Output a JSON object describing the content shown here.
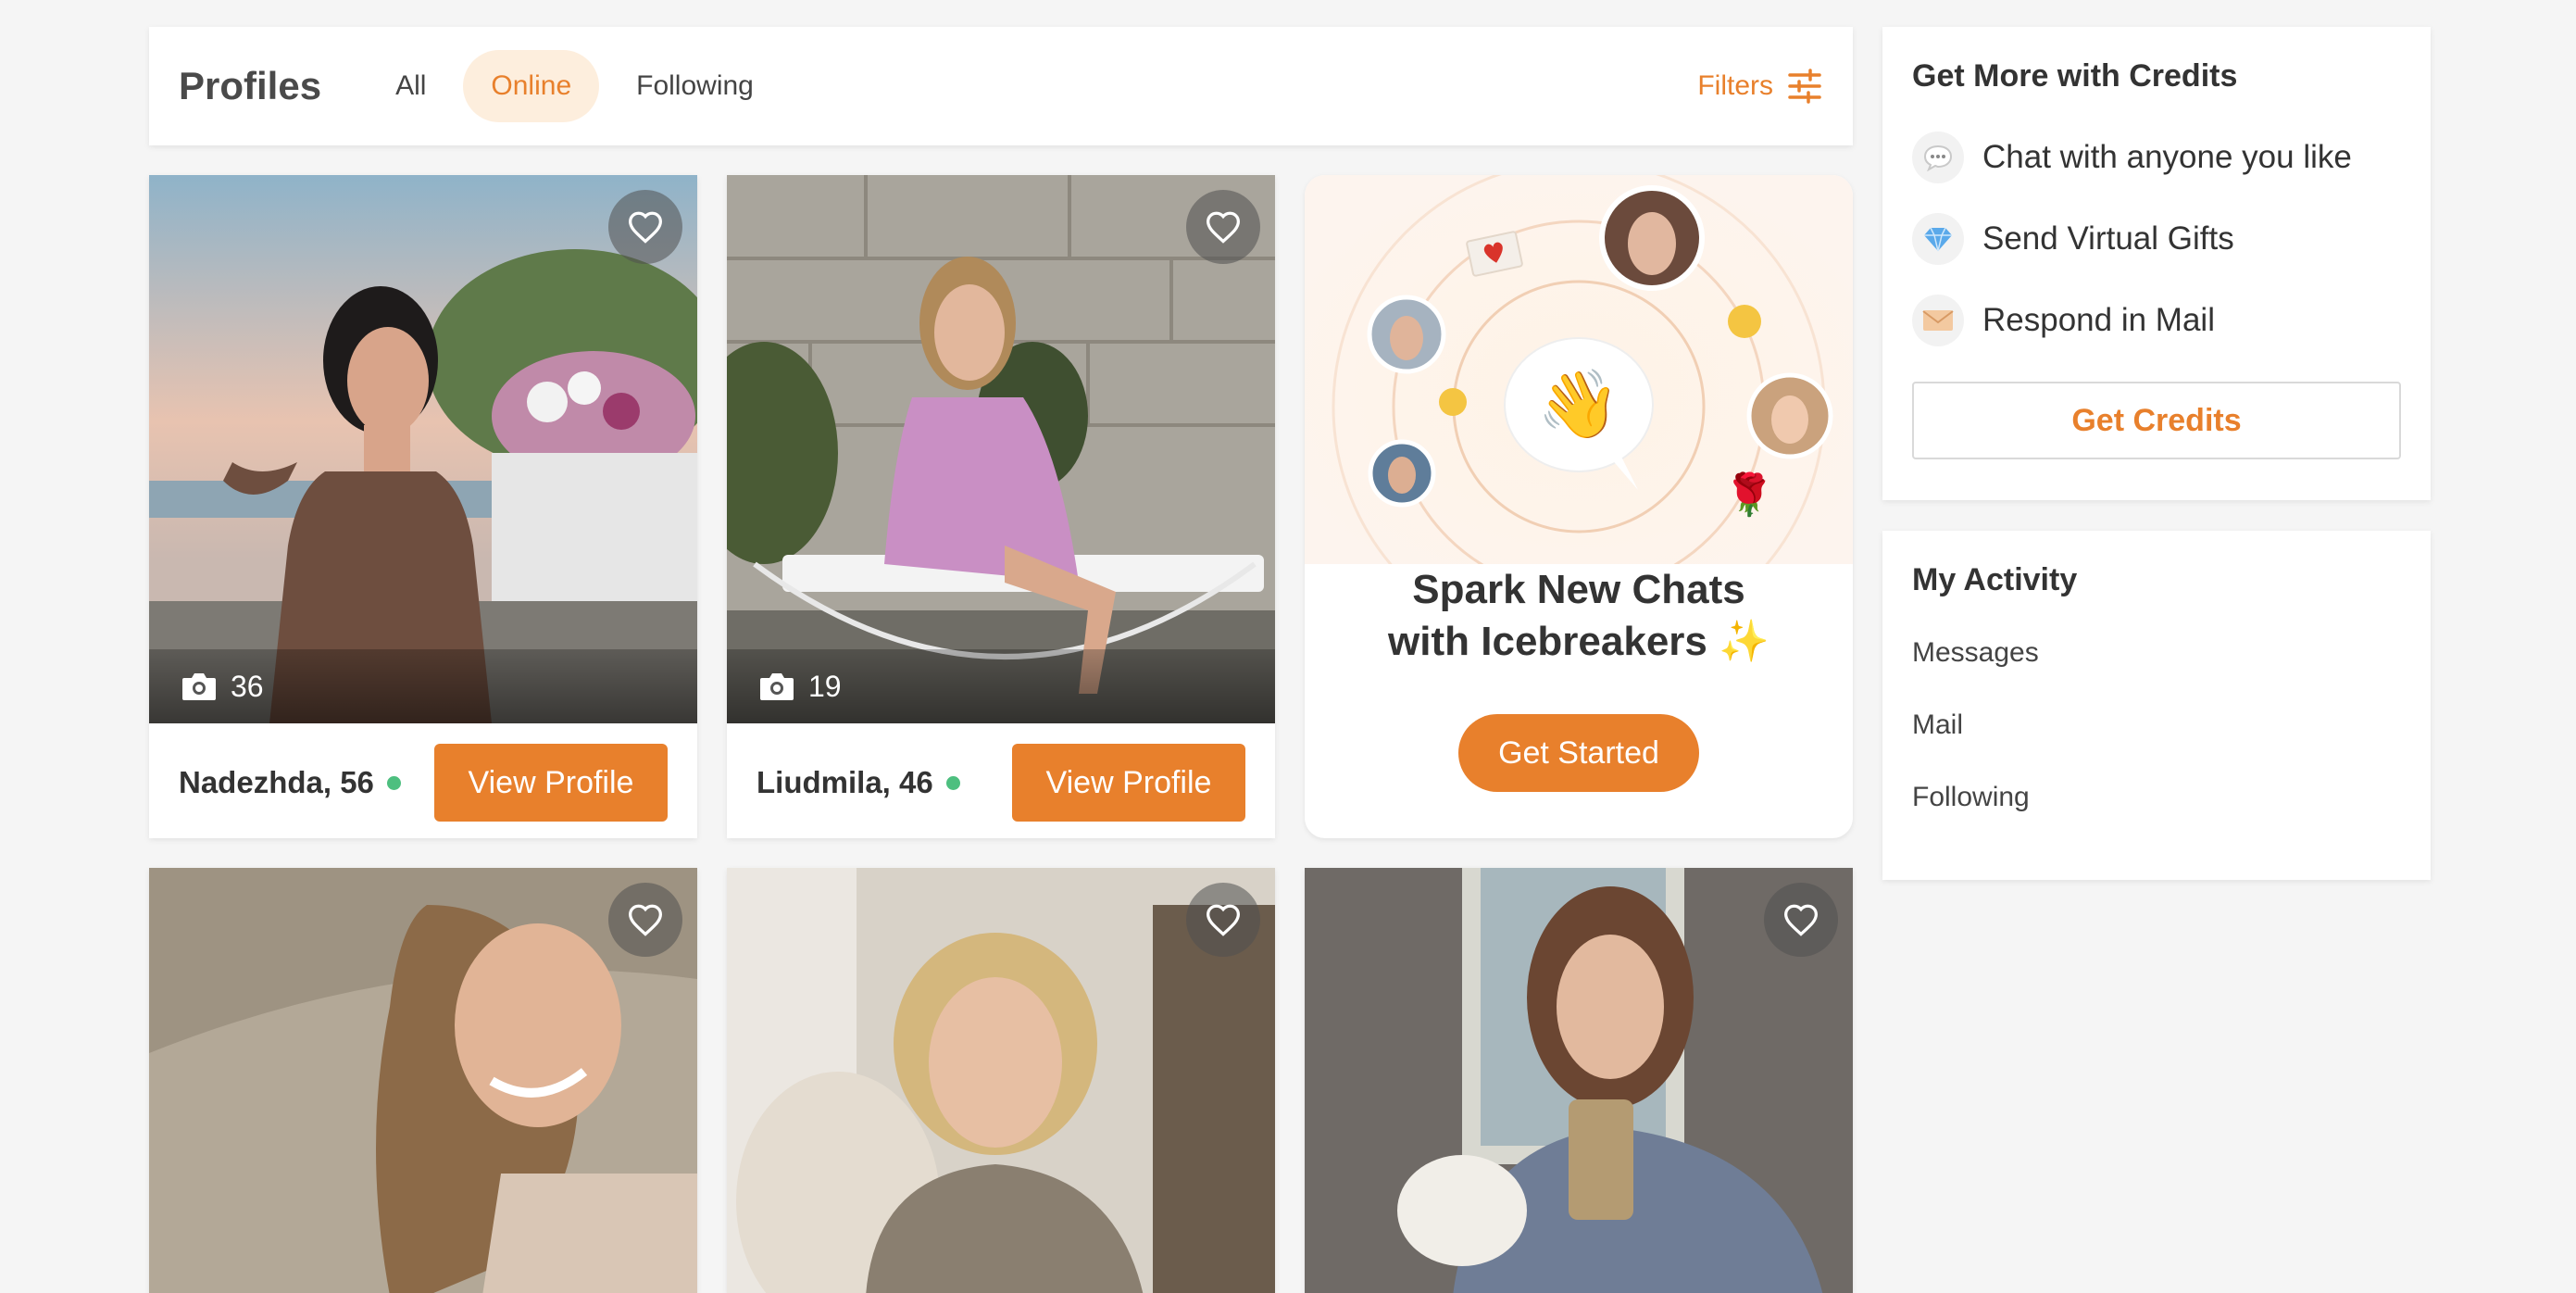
{
  "header": {
    "title": "Profiles",
    "tabs": [
      {
        "label": "All",
        "active": false
      },
      {
        "label": "Online",
        "active": true
      },
      {
        "label": "Following",
        "active": false
      }
    ],
    "filters_label": "Filters"
  },
  "profiles": [
    {
      "name": "Nadezhda, 56",
      "photo_count": "36",
      "online": true,
      "button": "View Profile"
    },
    {
      "name": "Liudmila, 46",
      "photo_count": "19",
      "online": true,
      "button": "View Profile"
    }
  ],
  "icebreaker": {
    "title_line1": "Spark New Chats",
    "title_line2": "with Icebreakers",
    "sparkle": "✨",
    "button": "Get Started"
  },
  "credits": {
    "title": "Get More with Credits",
    "items": [
      {
        "icon": "chat-bubble-icon",
        "label": "Chat with anyone you like"
      },
      {
        "icon": "diamond-icon",
        "label": "Send Virtual Gifts"
      },
      {
        "icon": "envelope-icon",
        "label": "Respond in Mail"
      }
    ],
    "button": "Get Credits"
  },
  "activity": {
    "title": "My Activity",
    "links": [
      "Messages",
      "Mail",
      "Following"
    ]
  },
  "colors": {
    "accent": "#e8802c",
    "accent_light": "#fdeedd",
    "online": "#4dbf7f",
    "background": "#f5f5f5"
  }
}
